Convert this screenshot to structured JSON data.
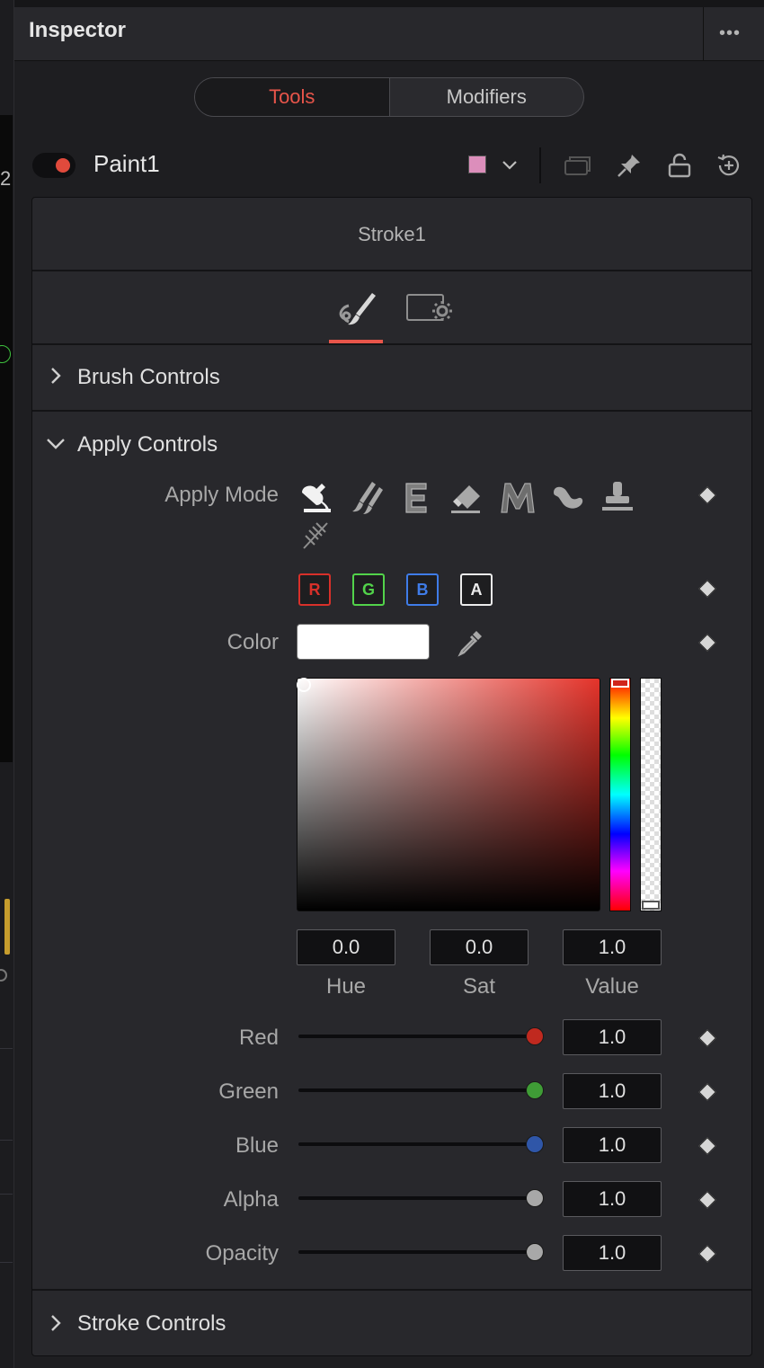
{
  "panel": {
    "title": "Inspector",
    "more_glyph": "•••"
  },
  "tabs": {
    "tools": "Tools",
    "modifiers": "Modifiers",
    "active": "tools"
  },
  "left_panel": {
    "partial_text": "2"
  },
  "node": {
    "name": "Paint1",
    "color_swatch": "#dc8ebb",
    "enabled": true
  },
  "stroke": {
    "title": "Stroke1"
  },
  "sections": {
    "brush": "Brush Controls",
    "apply": "Apply Controls",
    "stroke": "Stroke Controls"
  },
  "apply": {
    "mode_label": "Apply Mode",
    "modes": [
      "color",
      "clone",
      "emboss",
      "erase",
      "merge",
      "smear",
      "stamp",
      "wire"
    ],
    "channels": [
      {
        "label": "R",
        "color": "#d8302a"
      },
      {
        "label": "G",
        "color": "#52d34a"
      },
      {
        "label": "B",
        "color": "#3f7ce8"
      },
      {
        "label": "A",
        "color": "#ececec"
      }
    ],
    "color_label": "Color",
    "color_value": "#ffffff",
    "hsv": [
      {
        "label": "Hue",
        "value": "0.0"
      },
      {
        "label": "Sat",
        "value": "0.0"
      },
      {
        "label": "Value",
        "value": "1.0"
      }
    ],
    "sliders": [
      {
        "label": "Red",
        "value": "1.0",
        "knob": "#c0291f"
      },
      {
        "label": "Green",
        "value": "1.0",
        "knob": "#3f9c36"
      },
      {
        "label": "Blue",
        "value": "1.0",
        "knob": "#2f56a8"
      },
      {
        "label": "Alpha",
        "value": "1.0",
        "knob": "#a8a8a8"
      },
      {
        "label": "Opacity",
        "value": "1.0",
        "knob": "#a8a8a8"
      }
    ]
  }
}
